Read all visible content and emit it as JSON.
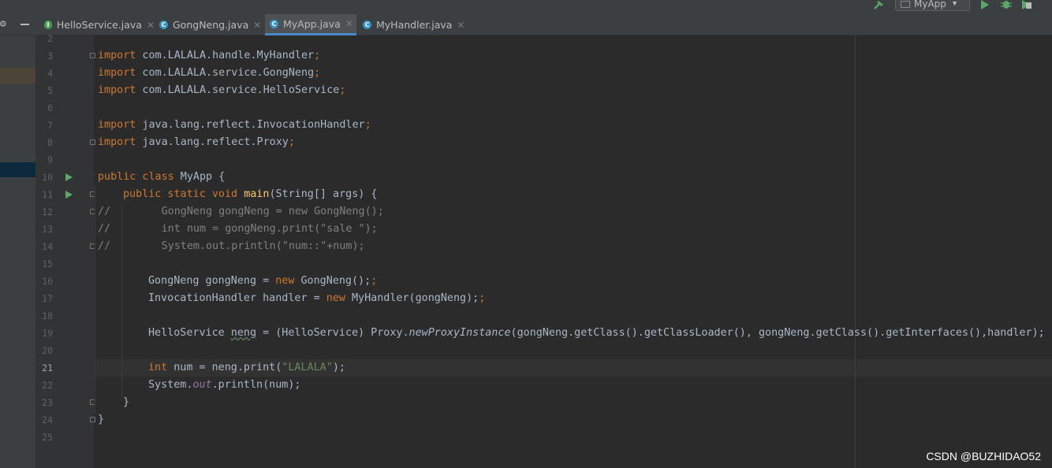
{
  "toolbar": {
    "run_config": "MyApp",
    "hammer_icon": "hammer-icon",
    "run_icon": "run-icon",
    "debug_icon": "debug-icon",
    "coverage_icon": "coverage-icon"
  },
  "tabs": [
    {
      "label": "HelloService.java",
      "icon": "I",
      "icon_color": "#499c54",
      "active": false
    },
    {
      "label": "GongNeng.java",
      "icon": "C",
      "icon_color": "#3592c4",
      "active": false
    },
    {
      "label": "MyApp.java",
      "icon": "C",
      "icon_color": "#3592c4",
      "active": true
    },
    {
      "label": "MyHandler.java",
      "icon": "C",
      "icon_color": "#3592c4",
      "active": false
    }
  ],
  "line_numbers": [
    "2",
    "3",
    "4",
    "5",
    "6",
    "7",
    "8",
    "9",
    "10",
    "11",
    "12",
    "13",
    "14",
    "15",
    "16",
    "17",
    "18",
    "19",
    "20",
    "21",
    "22",
    "23",
    "24",
    "25"
  ],
  "code": {
    "l3_pkg": " com.LALALA.handle.MyHandler",
    "l4_pkg": " com.LALALA.service.GongNeng",
    "l5_pkg": " com.LALALA.service.HelloService",
    "l7_pkg": " java.lang.reflect.InvocationHandler",
    "l8_pkg": " java.lang.reflect.Proxy",
    "import_kw": "import",
    "semi": ";",
    "l10_kw": "public class",
    "l10_rest": " MyApp {",
    "l11_kw": "public static void",
    "l11_fn": "main",
    "l11_rest": "(String[] args) {",
    "l12": "//        GongNeng gongNeng = new GongNeng();",
    "l13": "//        int num = gongNeng.print(\"sale \");",
    "l14": "//        System.out.println(\"num::\"+num);",
    "l16_a": "GongNeng gongNeng = ",
    "new_kw": "new",
    "l16_b": " GongNeng();",
    "l17_a": "InvocationHandler handler = ",
    "l17_b": " MyHandler(gongNeng);",
    "l19_a": "HelloService ",
    "l19_var": "neng",
    "l19_b": " = (HelloService) Proxy.",
    "l19_m": "newProxyInstance",
    "l19_c": "(gongNeng.getClass().getClassLoader(), gongNeng.getClass().getInterfaces(),handler);",
    "int_kw": "int",
    "l21_a": " num = neng.print(",
    "l21_str": "\"LALALA\"",
    "l21_b": ");",
    "l22_a": "System.",
    "l22_out": "out",
    "l22_b": ".println(num);",
    "close_brace": "}"
  },
  "watermark": "CSDN @BUZHIDAO52"
}
